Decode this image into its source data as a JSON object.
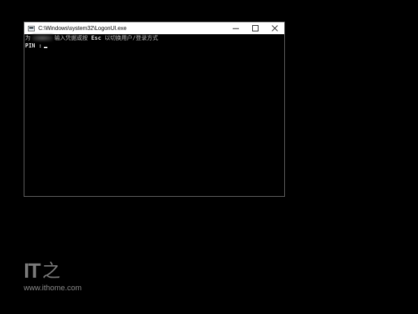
{
  "window": {
    "title": "C:\\Windows\\system32\\LogonUI.exe",
    "icon": "console-window-icon",
    "controls": {
      "minimize": "—",
      "maximize": "☐",
      "close": "✕"
    }
  },
  "console": {
    "line1_prefix": "为",
    "line1_middle": "输入凭据或按 ",
    "line1_key": "Esc",
    "line1_suffix": " 以切换用户/登录方式",
    "line2_label": "PIN :"
  },
  "watermark": {
    "logo_text": "IT",
    "logo_glyph": "之",
    "url": "www.ithome.com"
  }
}
